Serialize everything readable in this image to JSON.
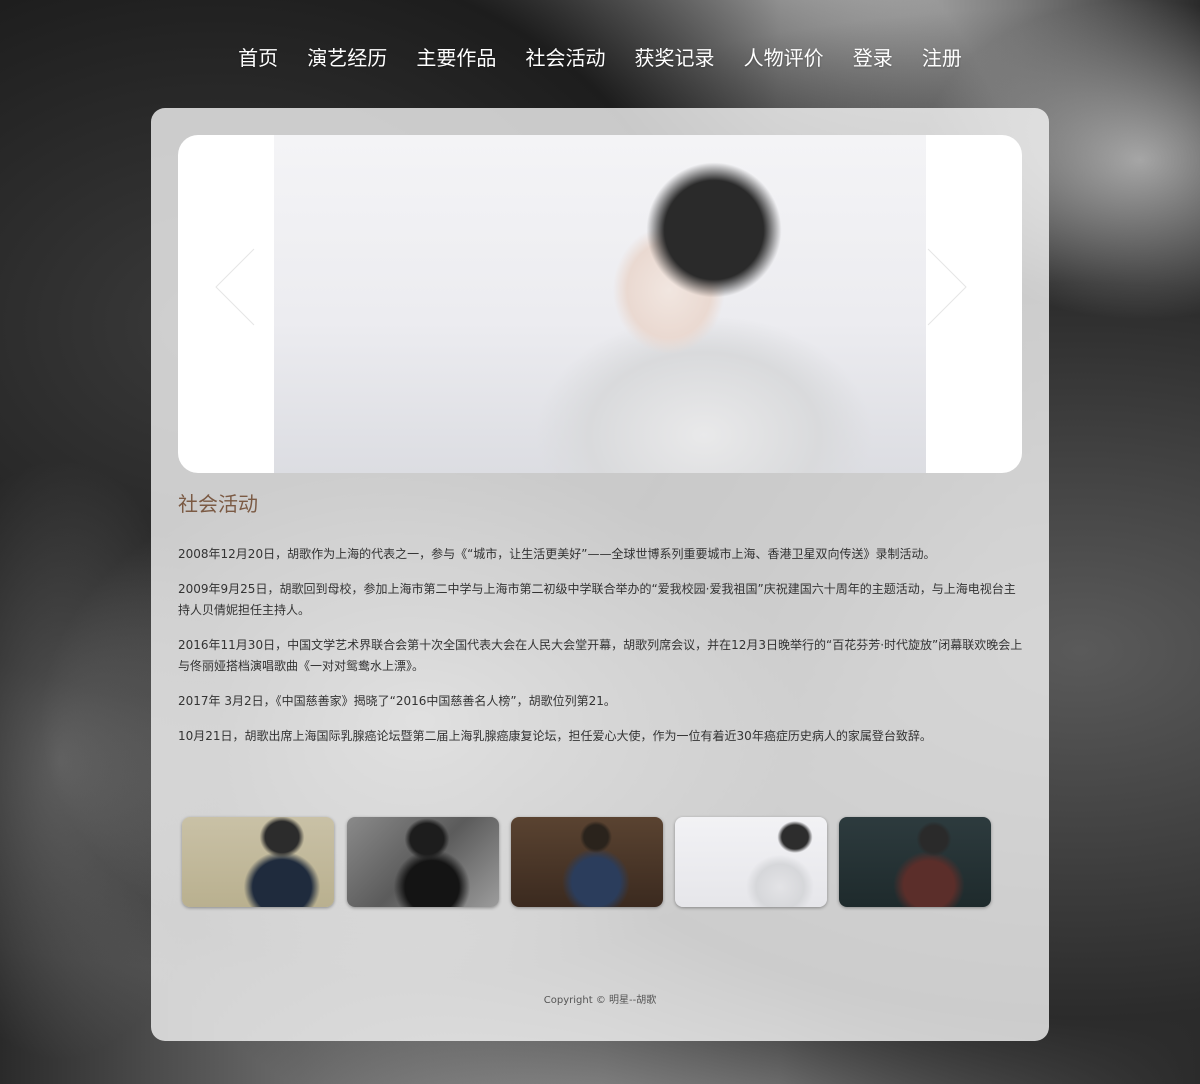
{
  "nav": {
    "items": [
      {
        "label": "首页"
      },
      {
        "label": "演艺经历"
      },
      {
        "label": "主要作品"
      },
      {
        "label": "社会活动"
      },
      {
        "label": "获奖记录"
      },
      {
        "label": "人物评价"
      },
      {
        "label": "登录"
      },
      {
        "label": "注册"
      }
    ]
  },
  "carousel": {
    "prev_icon": "chevron-left-icon",
    "next_icon": "chevron-right-icon"
  },
  "section": {
    "title": "社会活动",
    "paragraphs": [
      "2008年12月20日，胡歌作为上海的代表之一，参与《“城市，让生活更美好”——全球世博系列重要城市上海、香港卫星双向传送》录制活动。",
      "2009年9月25日，胡歌回到母校，参加上海市第二中学与上海市第二初级中学联合举办的“爱我校园·爱我祖国”庆祝建国六十周年的主题活动，与上海电视台主持人贝倩妮担任主持人。",
      "2016年11月30日，中国文学艺术界联合会第十次全国代表大会在人民大会堂开幕，胡歌列席会议，并在12月3日晚举行的“百花芬芳·时代旋放”闭幕联欢晚会上与佟丽娅搭档演唱歌曲《一对对鸳鸯水上漂》。",
      "2017年 3月2日，《中国慈善家》揭晓了“2016中国慈善名人榜”，胡歌位列第21。",
      "10月21日，胡歌出席上海国际乳腺癌论坛暨第二届上海乳腺癌康复论坛，担任爱心大使，作为一位有着近30年癌症历史病人的家属登台致辞。"
    ]
  },
  "footer": {
    "text": "Copyright © 明星--胡歌"
  }
}
